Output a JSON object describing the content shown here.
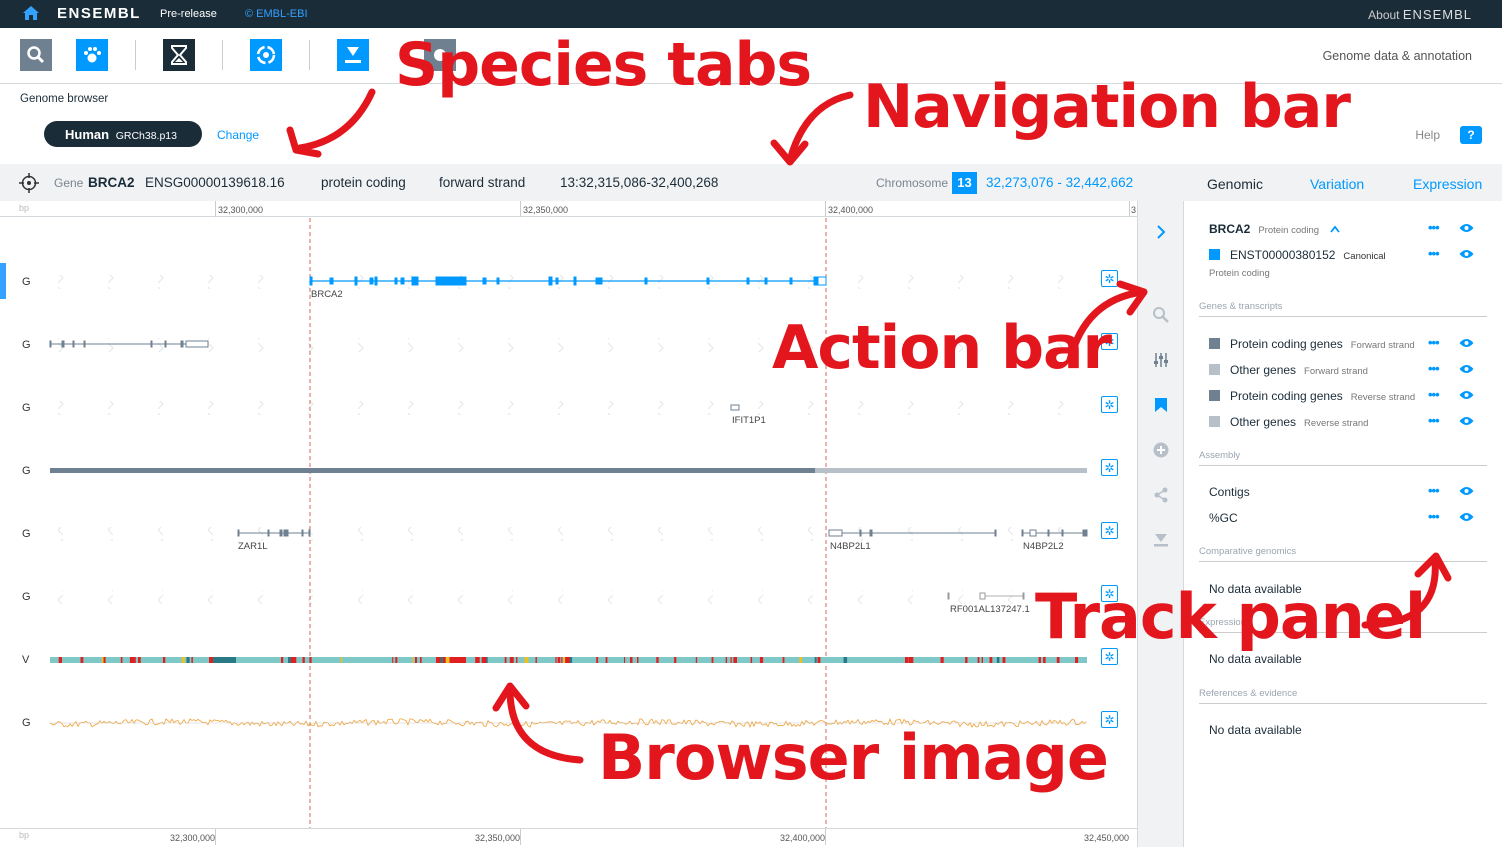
{
  "topbar": {
    "logo": "ENSEMBL",
    "prerelease": "Pre-release",
    "copyright": "© EMBL-EBI",
    "about_prefix": "About",
    "about_brand": "ENSEMBL"
  },
  "appbar": {
    "icons": [
      "search-icon",
      "species-selector-icon",
      "hourglass-icon",
      "genome-browser-icon",
      "download-icon",
      "unknown-app-icon"
    ],
    "right_text": "Genome data & annotation"
  },
  "species": {
    "section_label": "Genome browser",
    "tab_name": "Human",
    "tab_assembly": "GRCh38.p13",
    "change_label": "Change",
    "help_label": "Help",
    "help_icon": "?"
  },
  "nav": {
    "gene_label": "Gene",
    "gene_symbol": "BRCA2",
    "gene_id": "ENSG00000139618.16",
    "biotype": "protein coding",
    "strand": "forward strand",
    "location": "13:32,315,086-32,400,268",
    "chromosome_label": "Chromosome",
    "chromosome": "13",
    "range": "32,273,076 - 32,442,662",
    "tabs": [
      "Genomic",
      "Variation",
      "Expression"
    ],
    "active_tab": "Genomic"
  },
  "browser": {
    "bp_label": "bp",
    "ruler_top": [
      "32,300,000",
      "32,350,000",
      "32,400,000",
      "3"
    ],
    "ruler_bottom": [
      "32,300,000",
      "32,350,000",
      "32,400,000",
      "32,450,000"
    ],
    "track_labels": [
      "G",
      "G",
      "G",
      "G",
      "G",
      "G",
      "V",
      "G"
    ],
    "feature_labels": {
      "brca2": "BRCA2",
      "ifit1p1": "IFIT1P1",
      "zar1l": "ZAR1L",
      "n4bp2l1": "N4BP2L1",
      "n4bp2l2": "N4BP2L2",
      "rf": "RF001AL137247.1"
    }
  },
  "action_bar": {
    "icons": [
      "chevron-right-icon",
      "search-icon",
      "sliders-icon",
      "bookmark-icon",
      "add-circle-icon",
      "share-icon",
      "download-icon"
    ]
  },
  "panel": {
    "gene": {
      "name": "BRCA2",
      "biotype": "Protein coding"
    },
    "transcript": {
      "id": "ENST00000380152",
      "tag": "Canonical",
      "biotype": "Protein coding"
    },
    "sections": {
      "genes": "Genes & transcripts",
      "assembly": "Assembly",
      "comparative": "Comparative genomics",
      "expression": "Expression",
      "references": "References & evidence"
    },
    "gene_tracks": [
      {
        "name": "Protein coding genes",
        "strand": "Forward strand",
        "color": "#6f8190"
      },
      {
        "name": "Other genes",
        "strand": "Forward strand",
        "color": "#b7c0c8"
      },
      {
        "name": "Protein coding genes",
        "strand": "Reverse strand",
        "color": "#6f8190"
      },
      {
        "name": "Other genes",
        "strand": "Reverse strand",
        "color": "#b7c0c8"
      }
    ],
    "assembly_tracks": [
      "Contigs",
      "%GC"
    ],
    "no_data": "No data available"
  },
  "annotations": {
    "species_tabs": "Species tabs",
    "navigation_bar": "Navigation bar",
    "action_bar": "Action bar",
    "track_panel": "Track panel",
    "browser_image": "Browser image"
  },
  "colors": {
    "accent": "#0099ff",
    "dark": "#1b2c39",
    "annotation_red": "#e3161e",
    "gene_blue": "#0099ff",
    "gene_grey": "#6f8190"
  }
}
